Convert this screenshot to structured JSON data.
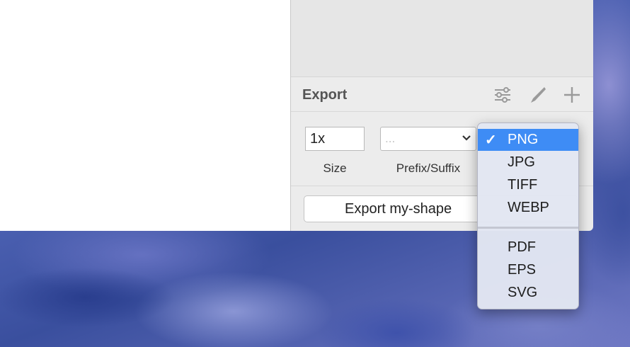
{
  "export_panel": {
    "title": "Export",
    "size": {
      "value": "1x",
      "label": "Size"
    },
    "prefix_suffix": {
      "placeholder": "...",
      "label": "Prefix/Suffix"
    },
    "export_button_label": "Export my-shape",
    "icons": [
      "sliders-icon",
      "slice-knife-icon",
      "plus-icon"
    ]
  },
  "format_dropdown": {
    "selected": "PNG",
    "check_mark": "✓",
    "raster": [
      "PNG",
      "JPG",
      "TIFF",
      "WEBP"
    ],
    "vector": [
      "PDF",
      "EPS",
      "SVG"
    ]
  },
  "colors": {
    "accent_selected": "#3e8cf5",
    "panel_bg": "#ececec",
    "title_text": "#555555"
  }
}
